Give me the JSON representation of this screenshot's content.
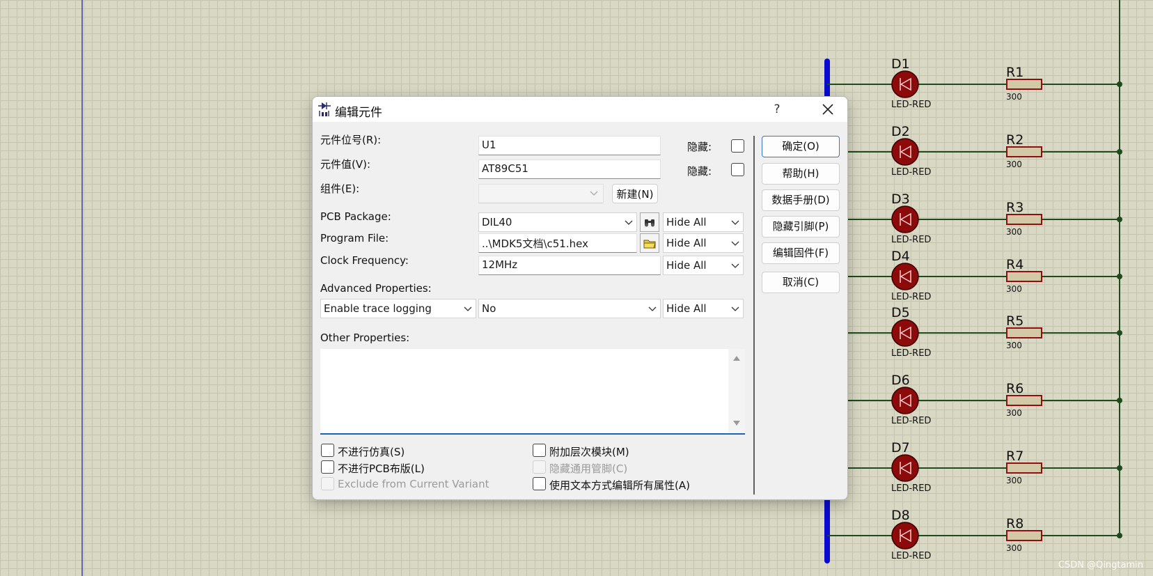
{
  "dialog": {
    "title": "编辑元件",
    "help_glyph": "?",
    "fields": {
      "ref_label": "元件位号(R):",
      "ref_value": "U1",
      "val_label": "元件值(V):",
      "val_value": "AT89C51",
      "group_label": "组件(E):",
      "group_value": "",
      "hide_label": "隐藏:",
      "new_button": "新建(N)"
    },
    "props": {
      "pcb_label": "PCB Package:",
      "pcb_value": "DIL40",
      "prog_label": "Program File:",
      "prog_value": "..\\MDK5文档\\c51.hex",
      "clock_label": "Clock Frequency:",
      "clock_value": "12MHz",
      "hide_option": "Hide All",
      "advanced_label": "Advanced Properties:",
      "advanced_name": "Enable trace logging",
      "advanced_value": "No",
      "other_label": "Other Properties:"
    },
    "buttons": {
      "ok": "确定(O)",
      "help": "帮助(H)",
      "datasheet": "数据手册(D)",
      "hidden_pins": "隐藏引脚(P)",
      "edit_firmware": "编辑固件(F)",
      "cancel": "取消(C)"
    },
    "options": {
      "no_sim": "不进行仿真(S)",
      "no_pcb": "不进行PCB布版(L)",
      "exclude_variant": "Exclude from Current Variant",
      "attach_module": "附加层次模块(M)",
      "hide_common_pins": "隐藏通用管脚(C)",
      "edit_as_text": "使用文本方式编辑所有属性(A)"
    }
  },
  "schematic": {
    "components": [
      {
        "diode": "D1",
        "diode_type": "LED-RED",
        "resistor": "R1",
        "resistor_value": "300"
      },
      {
        "diode": "D2",
        "diode_type": "LED-RED",
        "resistor": "R2",
        "resistor_value": "300"
      },
      {
        "diode": "D3",
        "diode_type": "LED-RED",
        "resistor": "R3",
        "resistor_value": "300"
      },
      {
        "diode": "D4",
        "diode_type": "LED-RED",
        "resistor": "R4",
        "resistor_value": "300"
      },
      {
        "diode": "D5",
        "diode_type": "LED-RED",
        "resistor": "R5",
        "resistor_value": "300"
      },
      {
        "diode": "D6",
        "diode_type": "LED-RED",
        "resistor": "R6",
        "resistor_value": "300"
      },
      {
        "diode": "D7",
        "diode_type": "LED-RED",
        "resistor": "R7",
        "resistor_value": "300"
      },
      {
        "diode": "D8",
        "diode_type": "LED-RED",
        "resistor": "R8",
        "resistor_value": "300"
      }
    ],
    "colors": {
      "grid_bg": "#d8d8c4",
      "wire": "#1e4a1e",
      "bus": "#0a0ad0",
      "led_body": "#8c0a0a",
      "resistor_fill": "#d3c9a6",
      "resistor_stroke": "#8c1010"
    },
    "watermark": "CSDN @Qingtamin"
  }
}
